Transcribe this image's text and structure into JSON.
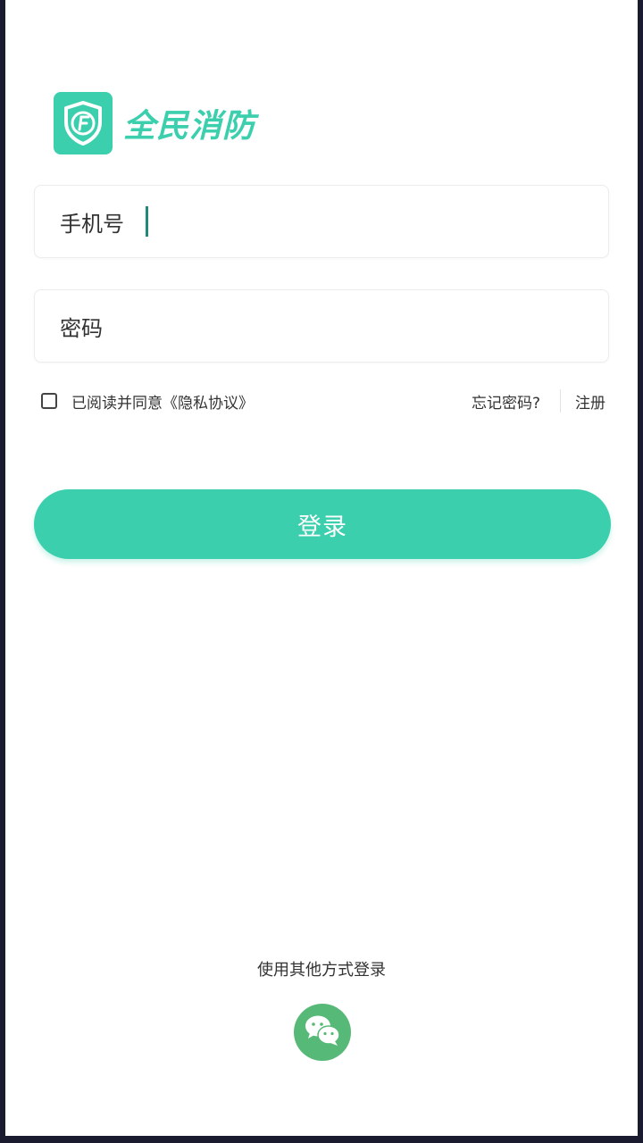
{
  "app": {
    "logo_text": "全民消防"
  },
  "form": {
    "phone_label": "手机号",
    "phone_value": "",
    "password_label": "密码",
    "password_value": ""
  },
  "agreement": {
    "text": "已阅读并同意《隐私协议》",
    "checked": false
  },
  "links": {
    "forgot_password": "忘记密码?",
    "register": "注册"
  },
  "login_button": "登录",
  "other_login": {
    "label": "使用其他方式登录",
    "methods": [
      {
        "icon": "wechat-icon"
      }
    ]
  },
  "colors": {
    "accent": "#3bcfad",
    "wechat": "#57b977",
    "cursor": "#1f8a7a"
  }
}
